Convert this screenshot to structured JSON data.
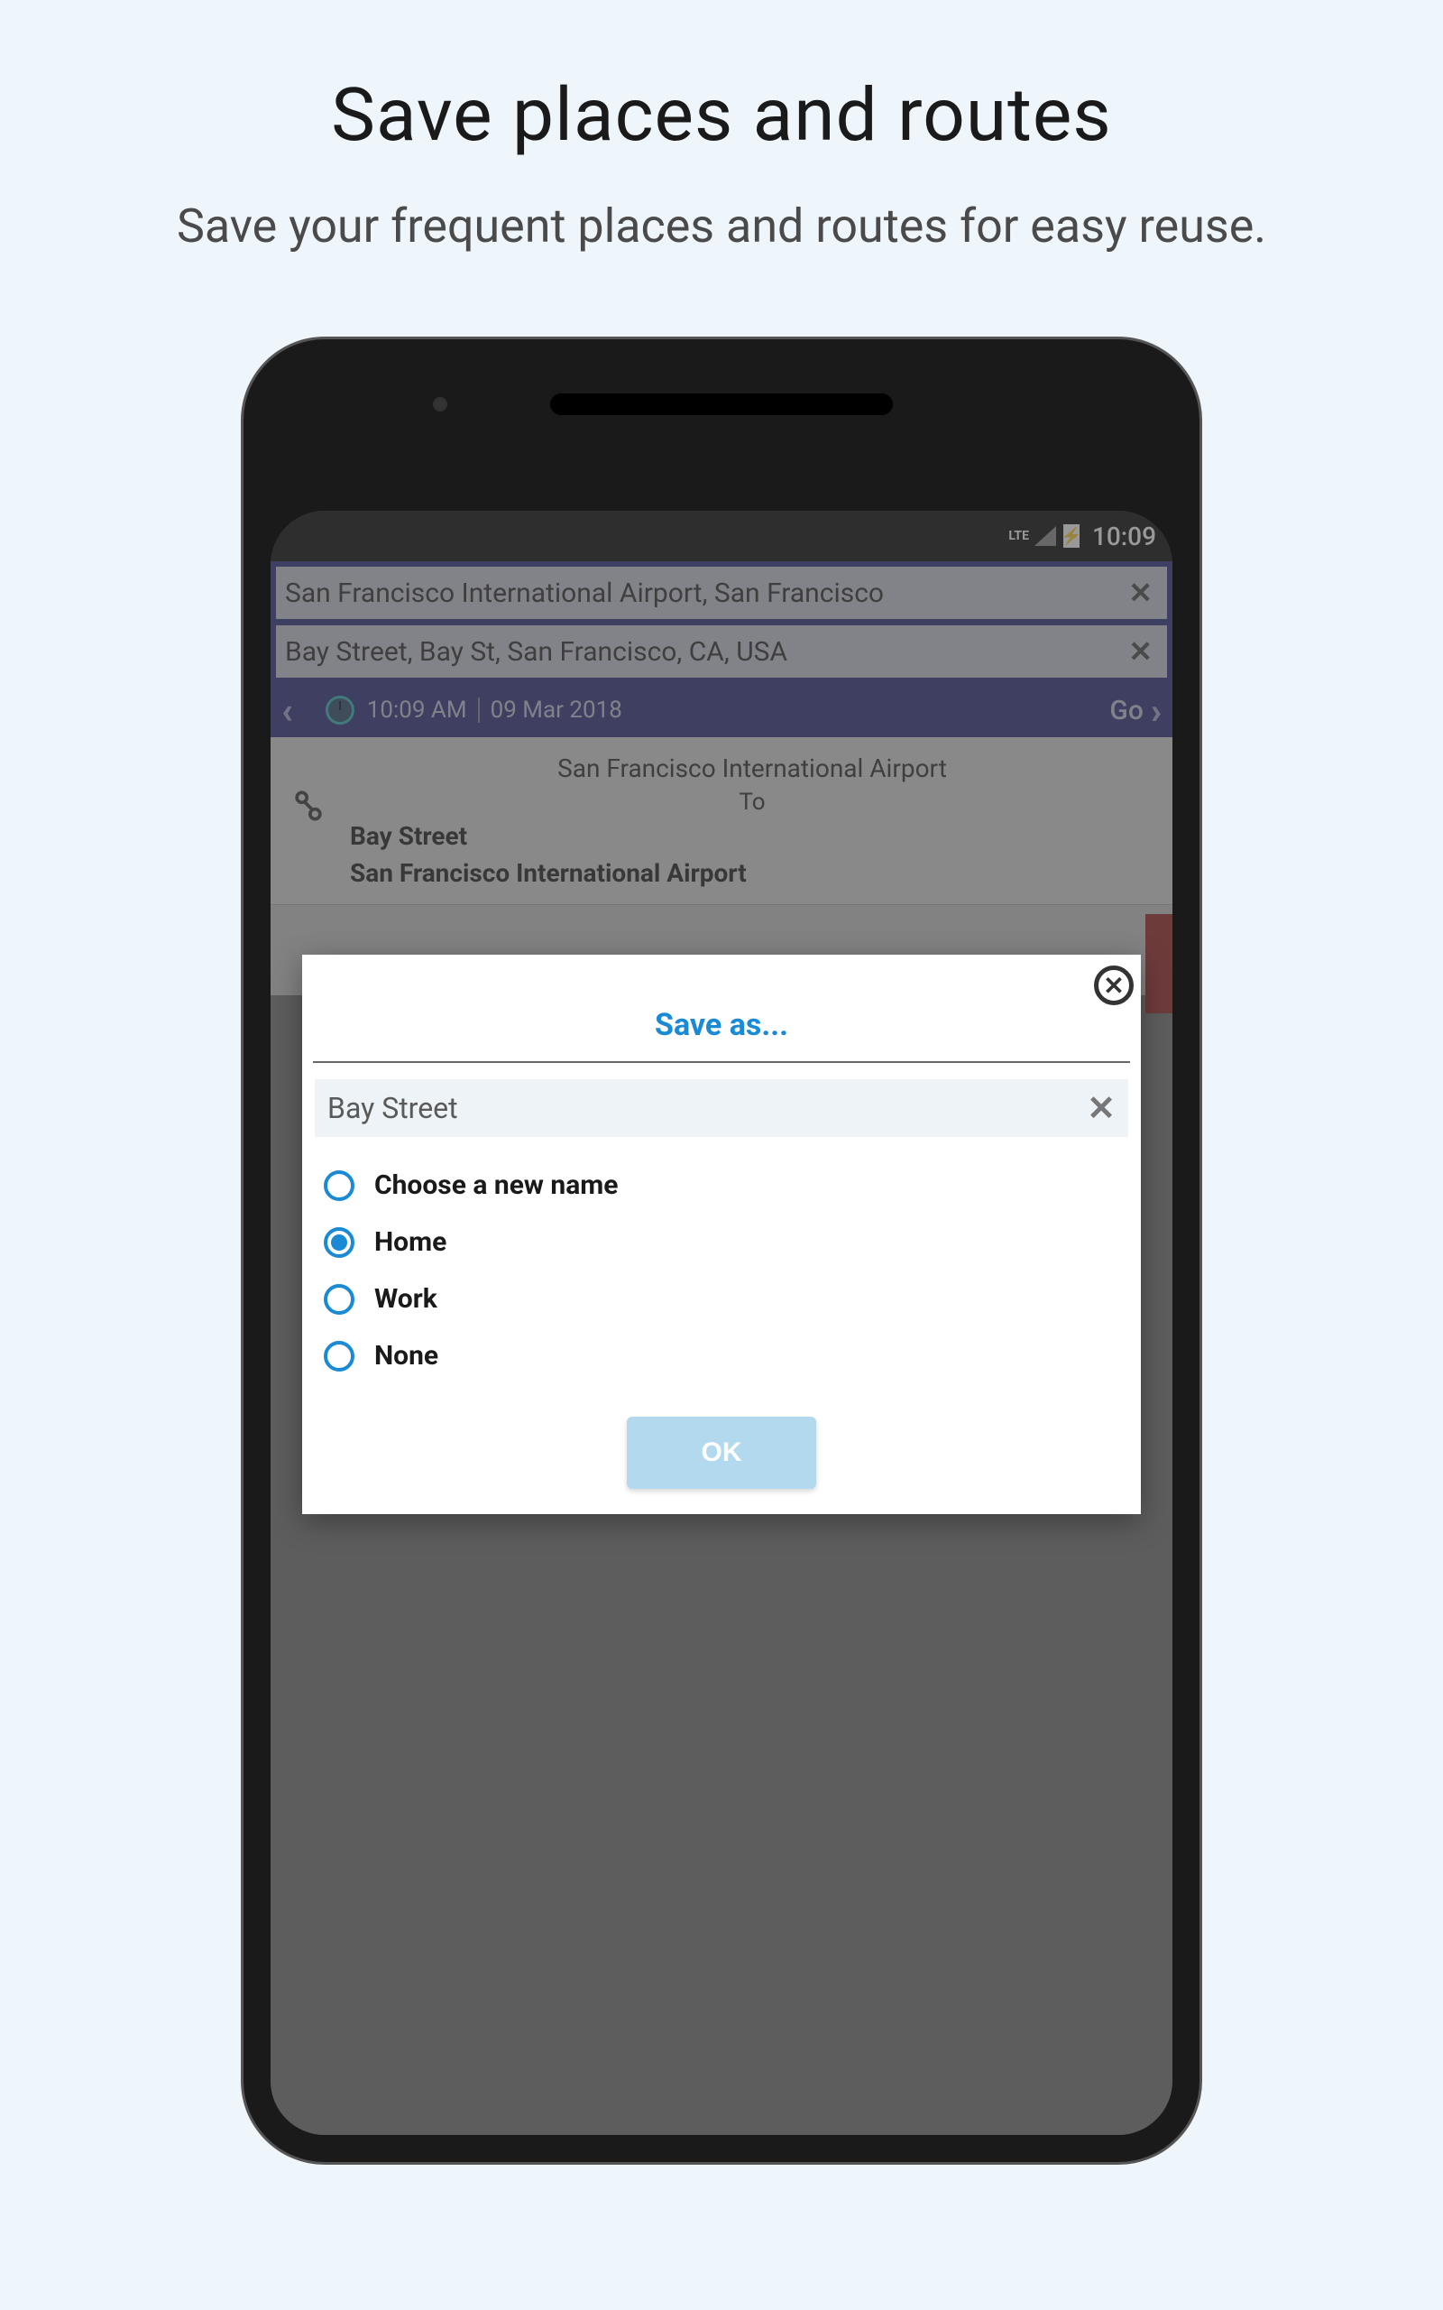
{
  "marketing": {
    "title": "Save places and routes",
    "subtitle": "Save your frequent places and routes for easy reuse."
  },
  "status_bar": {
    "network": "LTE",
    "battery_icon": "⚡",
    "time": "10:09"
  },
  "search": {
    "from": "San Francisco International Airport, San Francisco",
    "to": "Bay Street, Bay St, San Francisco, CA, USA"
  },
  "time_row": {
    "time": "10:09 AM",
    "date": "09 Mar 2018",
    "go_label": "Go"
  },
  "route": {
    "from_label": "San Francisco International Airport",
    "to_word": "To",
    "to_label": "Bay Street",
    "next_label": "San Francisco International Airport"
  },
  "dialog": {
    "title": "Save as...",
    "name_value": "Bay Street",
    "options": [
      {
        "label": "Choose a new name",
        "selected": false
      },
      {
        "label": "Home",
        "selected": true
      },
      {
        "label": "Work",
        "selected": false
      },
      {
        "label": "None",
        "selected": false
      }
    ],
    "ok_label": "OK"
  }
}
